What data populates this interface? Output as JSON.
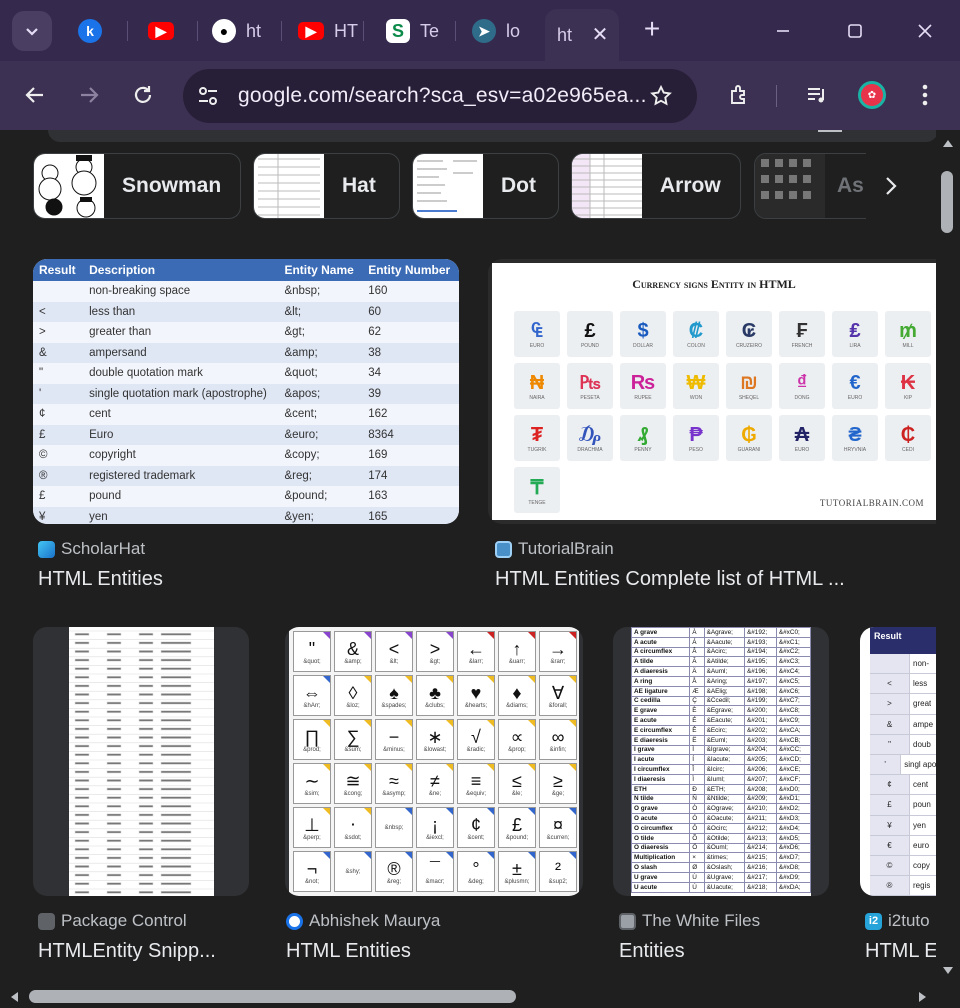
{
  "tabs": [
    {
      "label": "",
      "icon": "blue-k-icon"
    },
    {
      "label": "",
      "icon": "youtube-icon"
    },
    {
      "label": "ht",
      "icon": "github-icon"
    },
    {
      "label": "HT",
      "icon": "youtube-icon"
    },
    {
      "label": "Te",
      "icon": "green-s-icon"
    },
    {
      "label": "lo",
      "icon": "cursor-icon"
    },
    {
      "label": "ht",
      "icon": "",
      "active": true
    }
  ],
  "toolbar": {
    "url": "google.com/search?sca_esv=a02e965ea..."
  },
  "chips": [
    {
      "label": "Snowman"
    },
    {
      "label": "Hat"
    },
    {
      "label": "Dot"
    },
    {
      "label": "Arrow"
    },
    {
      "label": "As"
    }
  ],
  "results": [
    {
      "source": "ScholarHat",
      "title": "HTML Entities",
      "source_color": "#1a9bd7"
    },
    {
      "source": "TutorialBrain",
      "title": "HTML Entities Complete list of HTML ...",
      "source_color": "#4a90c8"
    },
    {
      "source": "Package Control",
      "title": "HTMLEntity Snipp...",
      "source_color": "#5f6368"
    },
    {
      "source": "Abhishek Maurya",
      "title": "HTML Entities",
      "source_color": "#1a73e8"
    },
    {
      "source": "The White Files",
      "title": "Entities",
      "source_color": "#9aa0a6"
    },
    {
      "source": "i2tuto",
      "title": "HTML E",
      "source_color": "#26a3d9"
    }
  ],
  "scholarhat_table": {
    "headers": [
      "Result",
      "Description",
      "Entity Name",
      "Entity Number"
    ],
    "rows": [
      [
        "",
        "non-breaking space",
        "&nbsp;",
        "160"
      ],
      [
        "<",
        "less than",
        "&lt;",
        "60"
      ],
      [
        ">",
        "greater than",
        "&gt;",
        "62"
      ],
      [
        "&",
        "ampersand",
        "&amp;",
        "38"
      ],
      [
        "\"",
        "double quotation mark",
        "&quot;",
        "34"
      ],
      [
        "'",
        "single quotation mark (apostrophe)",
        "&apos;",
        "39"
      ],
      [
        "¢",
        "cent",
        "&cent;",
        "162"
      ],
      [
        "£",
        "Euro",
        "&euro;",
        "8364"
      ],
      [
        "©",
        "copyright",
        "&copy;",
        "169"
      ],
      [
        "®",
        "registered trademark",
        "&reg;",
        "174"
      ],
      [
        "£",
        "pound",
        "&pound;",
        "163"
      ],
      [
        "¥",
        "yen",
        "&yen;",
        "165"
      ]
    ]
  },
  "currency": {
    "title": "Currency signs Entity in HTML",
    "footer": "TUTORIALBRAIN.COM",
    "items": [
      {
        "s": "₠",
        "n": "EURO",
        "color": "#3366cc"
      },
      {
        "s": "£",
        "n": "POUND",
        "color": "#111111"
      },
      {
        "s": "$",
        "n": "DOLLAR",
        "color": "#1a5bbf"
      },
      {
        "s": "₡",
        "n": "COLON",
        "color": "#2299cc"
      },
      {
        "s": "₢",
        "n": "CRUZEIRO",
        "color": "#2a3a66"
      },
      {
        "s": "₣",
        "n": "FRENCH",
        "color": "#333333"
      },
      {
        "s": "₤",
        "n": "LIRA",
        "color": "#5533aa"
      },
      {
        "s": "₥",
        "n": "MILL",
        "color": "#44aa33"
      },
      {
        "s": "₦",
        "n": "NAIRA",
        "color": "#ee8800"
      },
      {
        "s": "₧",
        "n": "PESETA",
        "color": "#dd3355"
      },
      {
        "s": "₨",
        "n": "RUPEE",
        "color": "#cc2299"
      },
      {
        "s": "₩",
        "n": "WON",
        "color": "#eebb00"
      },
      {
        "s": "₪",
        "n": "SHEQEL",
        "color": "#dd7722"
      },
      {
        "s": "₫",
        "n": "DONG",
        "color": "#cc33aa"
      },
      {
        "s": "€",
        "n": "EURO",
        "color": "#2266cc"
      },
      {
        "s": "₭",
        "n": "KIP",
        "color": "#dd3344"
      },
      {
        "s": "₮",
        "n": "TUGRIK",
        "color": "#dd2222"
      },
      {
        "s": "₯",
        "n": "DRACHMA",
        "color": "#3355bb"
      },
      {
        "s": "₰",
        "n": "PENNY",
        "color": "#33aa33"
      },
      {
        "s": "₱",
        "n": "PESO",
        "color": "#7733cc"
      },
      {
        "s": "₲",
        "n": "GUARANI",
        "color": "#eeaa00"
      },
      {
        "s": "₳",
        "n": "EURO",
        "color": "#222266"
      },
      {
        "s": "₴",
        "n": "HRYVNIA",
        "color": "#2266cc"
      },
      {
        "s": "₵",
        "n": "CEDI",
        "color": "#cc2222"
      },
      {
        "s": "₸",
        "n": "TENGE",
        "color": "#22aa55"
      }
    ]
  },
  "symbols": [
    {
      "g": "\"",
      "c": "&quot;",
      "k": "#8844cc"
    },
    {
      "g": "&",
      "c": "&amp;",
      "k": "#8844cc"
    },
    {
      "g": "<",
      "c": "&lt;",
      "k": "#8844cc"
    },
    {
      "g": ">",
      "c": "&gt;",
      "k": "#8844cc"
    },
    {
      "g": "←",
      "c": "&larr;",
      "k": "#cc2222"
    },
    {
      "g": "↑",
      "c": "&uarr;",
      "k": "#cc2222"
    },
    {
      "g": "→",
      "c": "&rarr;",
      "k": "#cc2222"
    },
    {
      "g": "⇔",
      "c": "&hArr;",
      "k": "#3366cc"
    },
    {
      "g": "◊",
      "c": "&loz;",
      "k": "#eebb22"
    },
    {
      "g": "♠",
      "c": "&spades;",
      "k": "#eebb22"
    },
    {
      "g": "♣",
      "c": "&clubs;",
      "k": "#eebb22"
    },
    {
      "g": "♥",
      "c": "&hearts;",
      "k": "#eebb22"
    },
    {
      "g": "♦",
      "c": "&diams;",
      "k": "#eebb22"
    },
    {
      "g": "∀",
      "c": "&forall;",
      "k": "#eebb22"
    },
    {
      "g": "∏",
      "c": "&prod;",
      "k": "#eebb22"
    },
    {
      "g": "∑",
      "c": "&sum;",
      "k": "#eebb22"
    },
    {
      "g": "−",
      "c": "&minus;",
      "k": "#eebb22"
    },
    {
      "g": "∗",
      "c": "&lowast;",
      "k": "#eebb22"
    },
    {
      "g": "√",
      "c": "&radic;",
      "k": "#eebb22"
    },
    {
      "g": "∝",
      "c": "&prop;",
      "k": "#eebb22"
    },
    {
      "g": "∞",
      "c": "&infin;",
      "k": "#eebb22"
    },
    {
      "g": "∼",
      "c": "&sim;",
      "k": "#eebb22"
    },
    {
      "g": "≅",
      "c": "&cong;",
      "k": "#eebb22"
    },
    {
      "g": "≈",
      "c": "&asymp;",
      "k": "#eebb22"
    },
    {
      "g": "≠",
      "c": "&ne;",
      "k": "#eebb22"
    },
    {
      "g": "≡",
      "c": "&equiv;",
      "k": "#eebb22"
    },
    {
      "g": "≤",
      "c": "&le;",
      "k": "#eebb22"
    },
    {
      "g": "≥",
      "c": "&ge;",
      "k": "#eebb22"
    },
    {
      "g": "⊥",
      "c": "&perp;",
      "k": "#eebb22"
    },
    {
      "g": "⋅",
      "c": "&sdot;",
      "k": "#eebb22"
    },
    {
      "g": " ",
      "c": "&nbsp;",
      "k": "#3366cc"
    },
    {
      "g": "¡",
      "c": "&iexcl;",
      "k": "#3366cc"
    },
    {
      "g": "¢",
      "c": "&cent;",
      "k": "#3366cc"
    },
    {
      "g": "£",
      "c": "&pound;",
      "k": "#3366cc"
    },
    {
      "g": "¤",
      "c": "&curren;",
      "k": "#3366cc"
    },
    {
      "g": "¬",
      "c": "&not;",
      "k": "#3366cc"
    },
    {
      "g": "",
      "c": "&shy;",
      "k": "#3366cc"
    },
    {
      "g": "®",
      "c": "&reg;",
      "k": "#3366cc"
    },
    {
      "g": "¯",
      "c": "&macr;",
      "k": "#3366cc"
    },
    {
      "g": "°",
      "c": "&deg;",
      "k": "#3366cc"
    },
    {
      "g": "±",
      "c": "&plusmn;",
      "k": "#3366cc"
    },
    {
      "g": "²",
      "c": "&sup2;",
      "k": "#3366cc"
    }
  ],
  "whitefiles": [
    [
      "A grave",
      "À",
      "&Agrave;",
      "&#192;",
      "&#xC0;"
    ],
    [
      "A acute",
      "Á",
      "&Aacute;",
      "&#193;",
      "&#xC1;"
    ],
    [
      "A circumflex",
      "Â",
      "&Acirc;",
      "&#194;",
      "&#xC2;"
    ],
    [
      "A tilde",
      "Ã",
      "&Atilde;",
      "&#195;",
      "&#xC3;"
    ],
    [
      "A diaeresis",
      "Ä",
      "&Auml;",
      "&#196;",
      "&#xC4;"
    ],
    [
      "A ring",
      "Å",
      "&Aring;",
      "&#197;",
      "&#xC5;"
    ],
    [
      "AE ligature",
      "Æ",
      "&AElig;",
      "&#198;",
      "&#xC6;"
    ],
    [
      "C cedilla",
      "Ç",
      "&Ccedil;",
      "&#199;",
      "&#xC7;"
    ],
    [
      "E grave",
      "È",
      "&Egrave;",
      "&#200;",
      "&#xC8;"
    ],
    [
      "E acute",
      "É",
      "&Eacute;",
      "&#201;",
      "&#xC9;"
    ],
    [
      "E circumflex",
      "Ê",
      "&Ecirc;",
      "&#202;",
      "&#xCA;"
    ],
    [
      "E diaeresis",
      "Ë",
      "&Euml;",
      "&#203;",
      "&#xCB;"
    ],
    [
      "I grave",
      "Ì",
      "&Igrave;",
      "&#204;",
      "&#xCC;"
    ],
    [
      "I acute",
      "Í",
      "&Iacute;",
      "&#205;",
      "&#xCD;"
    ],
    [
      "I circumflex",
      "Î",
      "&Icirc;",
      "&#206;",
      "&#xCE;"
    ],
    [
      "I diaeresis",
      "Ï",
      "&Iuml;",
      "&#207;",
      "&#xCF;"
    ],
    [
      "ETH",
      "Ð",
      "&ETH;",
      "&#208;",
      "&#xD0;"
    ],
    [
      "N tilde",
      "Ñ",
      "&Ntilde;",
      "&#209;",
      "&#xD1;"
    ],
    [
      "O grave",
      "Ò",
      "&Ograve;",
      "&#210;",
      "&#xD2;"
    ],
    [
      "O acute",
      "Ó",
      "&Oacute;",
      "&#211;",
      "&#xD3;"
    ],
    [
      "O circumflex",
      "Ô",
      "&Ocirc;",
      "&#212;",
      "&#xD4;"
    ],
    [
      "O tilde",
      "Õ",
      "&Otilde;",
      "&#213;",
      "&#xD5;"
    ],
    [
      "O diaeresis",
      "Ö",
      "&Ouml;",
      "&#214;",
      "&#xD6;"
    ],
    [
      "Multiplication",
      "×",
      "&times;",
      "&#215;",
      "&#xD7;"
    ],
    [
      "O slash",
      "Ø",
      "&Oslash;",
      "&#216;",
      "&#xD8;"
    ],
    [
      "U grave",
      "Ù",
      "&Ugrave;",
      "&#217;",
      "&#xD9;"
    ],
    [
      "U acute",
      "Ú",
      "&Uacute;",
      "&#218;",
      "&#xDA;"
    ]
  ],
  "i2tutorials": {
    "header": "Result",
    "rows": [
      {
        "sym": "",
        "desc": "non-"
      },
      {
        "sym": "<",
        "desc": "less"
      },
      {
        "sym": ">",
        "desc": "great"
      },
      {
        "sym": "&",
        "desc": "ampe"
      },
      {
        "sym": "\"",
        "desc": "doub"
      },
      {
        "sym": "'",
        "desc": "singl apostr"
      },
      {
        "sym": "¢",
        "desc": "cent"
      },
      {
        "sym": "£",
        "desc": "poun"
      },
      {
        "sym": "¥",
        "desc": "yen"
      },
      {
        "sym": "€",
        "desc": "euro"
      },
      {
        "sym": "©",
        "desc": "copy"
      },
      {
        "sym": "®",
        "desc": "regis"
      }
    ]
  }
}
